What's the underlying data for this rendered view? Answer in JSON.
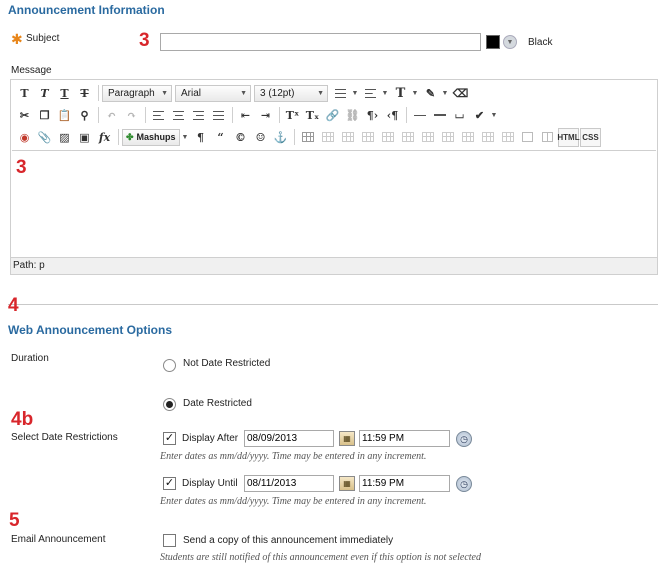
{
  "announcement_info": {
    "section_title": "Announcement Information",
    "subject_label": "Subject",
    "subject_value": "",
    "subject_color_label": "Black",
    "message_label": "Message"
  },
  "markers": {
    "subject": "3",
    "message": "3",
    "web_options": "4",
    "date_restrictions": "4b",
    "email": "5"
  },
  "editor": {
    "paragraph_format": "Paragraph",
    "font_family": "Arial",
    "font_size": "3 (12pt)",
    "mashups_label": "Mashups",
    "html_label": "HTML",
    "css_label": "CSS",
    "path_label": "Path:",
    "path_value": "p",
    "icons_row1": [
      "bold-icon",
      "italic-icon",
      "underline-icon",
      "strikethrough-icon"
    ],
    "icons_row2": [
      "cut-icon",
      "copy-icon",
      "paste-icon",
      "find-icon",
      "undo-icon",
      "redo-icon",
      "align-left-icon",
      "align-center-icon",
      "align-right-icon",
      "justify-icon",
      "outdent-icon",
      "indent-icon",
      "superscript-icon",
      "subscript-icon",
      "link-icon",
      "unlink-icon",
      "ltr-icon",
      "rtl-icon",
      "horizontal-rule-icon",
      "spellcheck-icon"
    ],
    "icons_row3": [
      "record-icon",
      "attach-icon",
      "image-icon",
      "media-icon",
      "math-icon",
      "paragraph-mark-icon",
      "quote-icon",
      "copyright-icon",
      "emoji-icon",
      "anchor-icon",
      "table-icon"
    ]
  },
  "web_options": {
    "section_title": "Web Announcement Options",
    "duration_label": "Duration",
    "not_restricted_label": "Not Date Restricted",
    "restricted_label": "Date Restricted",
    "select_restrictions_label": "Select Date Restrictions",
    "display_after_label": "Display After",
    "display_after_date": "08/09/2013",
    "display_after_time": "11:59 PM",
    "display_after_hint": "Enter dates as mm/dd/yyyy. Time may be entered in any increment.",
    "display_until_label": "Display Until",
    "display_until_date": "08/11/2013",
    "display_until_time": "11:59 PM",
    "display_until_hint": "Enter dates as mm/dd/yyyy. Time may be entered in any increment.",
    "email_label": "Email Announcement",
    "email_checkbox_label": "Send a copy of this announcement immediately",
    "email_hint": "Students are still notified of this announcement even if this option is not selected"
  },
  "colors": {
    "section_title": "#2a6aa0",
    "marker": "#d8262b",
    "required": "#e8861a"
  }
}
